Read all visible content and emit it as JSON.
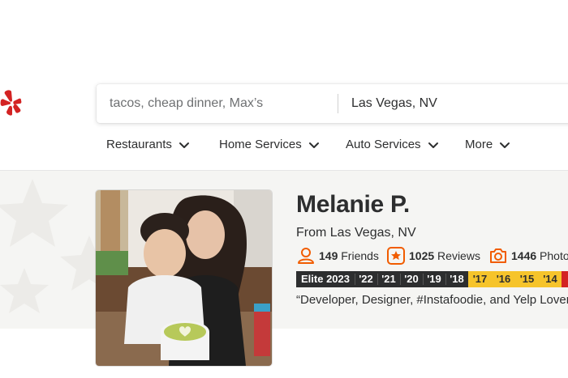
{
  "colors": {
    "brand_red": "#d32323",
    "icon_orange": "#f15c00",
    "elite_dark": "#2d2e2f",
    "elite_gold": "#f6c42b",
    "elite_red": "#d32323"
  },
  "header": {
    "logo_icon": "yelp-burst-icon"
  },
  "search": {
    "find_placeholder": "tacos, cheap dinner, Max’s",
    "near_value": "Las Vegas, NV"
  },
  "nav": {
    "items": [
      {
        "label": "Restaurants"
      },
      {
        "label": "Home Services"
      },
      {
        "label": "Auto Services"
      },
      {
        "label": "More"
      }
    ]
  },
  "profile": {
    "name": "Melanie P.",
    "location": "From Las Vegas, NV",
    "stats": {
      "friends_count": "149",
      "friends_label": "Friends",
      "reviews_count": "1025",
      "reviews_label": "Reviews",
      "photos_count": "1446",
      "photos_label": "Photos"
    },
    "elite_badges": [
      "Elite 2023",
      "'22",
      "'21",
      "'20",
      "'19",
      "'18",
      "'17",
      "'16",
      "'15",
      "'14"
    ],
    "bio": "“Developer, Designer, #Instafoodie, and Yelp Lover"
  }
}
